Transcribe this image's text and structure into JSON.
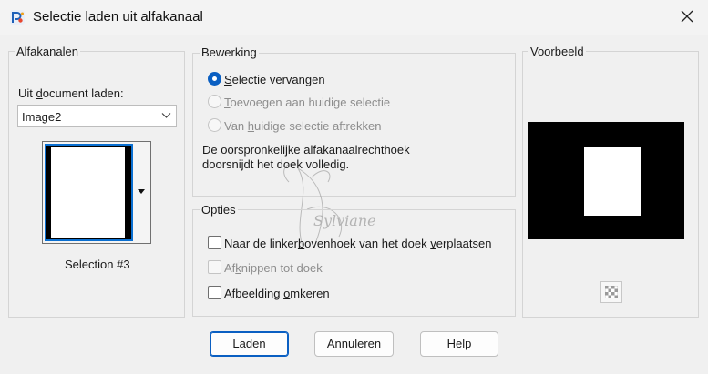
{
  "window": {
    "title": "Selectie laden uit alfakanaal",
    "icon": "paintshop-app-icon"
  },
  "alfakanalen": {
    "group_label": "Alfakanalen",
    "doc_label_pre": "Uit ",
    "doc_label_u": "d",
    "doc_label_post": "ocument laden:",
    "doc_value": "Image2",
    "selection_caption": "Selection #3"
  },
  "bewerking": {
    "group_label": "Bewerking",
    "options": [
      {
        "u": "S",
        "rest": "electie vervangen",
        "checked": true,
        "disabled": false
      },
      {
        "u": "T",
        "rest": "oevoegen aan huidige selectie",
        "checked": false,
        "disabled": true
      },
      {
        "pre": "Van ",
        "u": "h",
        "rest": "uidige selectie aftrekken",
        "checked": false,
        "disabled": true
      }
    ],
    "info": "De oorspronkelijke alfakanaalrechthoek doorsnijdt het doek volledig."
  },
  "opties": {
    "group_label": "Opties",
    "items": [
      {
        "pre": "Naar de linker",
        "u": "b",
        "rest": "ovenhoek van het doek ",
        "u2": "v",
        "rest2": "erplaatsen",
        "checked": false,
        "disabled": false
      },
      {
        "pre": "Af",
        "u": "k",
        "rest": "nippen tot doek",
        "checked": false,
        "disabled": true
      },
      {
        "pre": "Afbeelding ",
        "u": "o",
        "rest": "mkeren",
        "checked": false,
        "disabled": false
      }
    ]
  },
  "voorbeeld": {
    "group_label": "Voorbeeld"
  },
  "buttons": {
    "load": "Laden",
    "cancel": "Annuleren",
    "help": "Help"
  },
  "watermark": "Sylviane",
  "colors": {
    "accent": "#0a5fc2",
    "background": "#f0f0f0",
    "preview_bg": "#000000"
  }
}
